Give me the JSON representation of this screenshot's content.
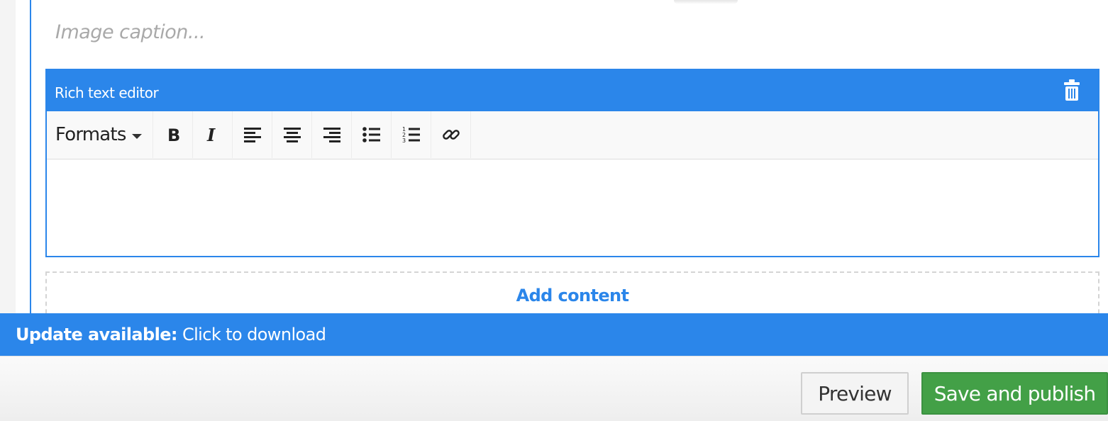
{
  "caption": {
    "placeholder": "Image caption..."
  },
  "editor": {
    "title": "Rich text editor",
    "toolbar": {
      "formats_label": "Formats",
      "buttons": [
        "bold-icon",
        "italic-icon",
        "align-left-icon",
        "align-center-icon",
        "align-right-icon",
        "bullet-list-icon",
        "numbered-list-icon",
        "link-icon"
      ]
    },
    "body_text": ""
  },
  "add_content": {
    "label": "Add content"
  },
  "update_bar": {
    "strong": "Update available:",
    "text": "Click to download"
  },
  "footer": {
    "preview_label": "Preview",
    "publish_label": "Save and publish"
  },
  "colors": {
    "accent": "#2b86ea",
    "publish": "#43a047"
  }
}
